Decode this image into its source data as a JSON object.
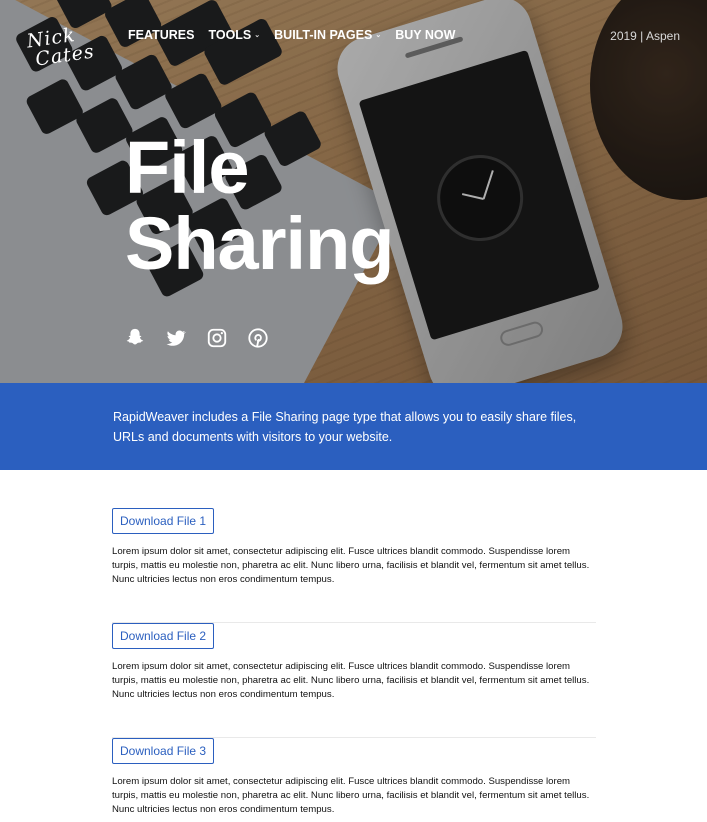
{
  "nav": {
    "logo_line1": "Nick",
    "logo_line2": "Cates",
    "items": [
      {
        "label": "FEATURES",
        "dropdown": false
      },
      {
        "label": "TOOLS",
        "dropdown": true
      },
      {
        "label": "BUILT-IN PAGES",
        "dropdown": true
      },
      {
        "label": "BUY NOW",
        "dropdown": false
      }
    ],
    "top_right": "2019 | Aspen"
  },
  "hero": {
    "title_line1": "File",
    "title_line2": "Sharing",
    "social_icons": [
      "snapchat-icon",
      "twitter-icon",
      "instagram-icon",
      "pinterest-icon"
    ]
  },
  "band": {
    "text": "RapidWeaver includes a File Sharing page type that allows you to easily share files, URLs and documents with visitors to your website."
  },
  "files": [
    {
      "button": "Download File 1",
      "description": "Lorem ipsum dolor sit amet, consectetur adipiscing elit. Fusce ultrices blandit commodo. Suspendisse lorem turpis, mattis eu molestie non, pharetra ac elit. Nunc libero urna, facilisis et blandit vel, fermentum sit amet tellus. Nunc ultricies lectus non eros condimentum tempus."
    },
    {
      "button": "Download File 2",
      "description": "Lorem ipsum dolor sit amet, consectetur adipiscing elit. Fusce ultrices blandit commodo. Suspendisse lorem turpis, mattis eu molestie non, pharetra ac elit. Nunc libero urna, facilisis et blandit vel, fermentum sit amet tellus. Nunc ultricies lectus non eros condimentum tempus."
    },
    {
      "button": "Download File 3",
      "description": "Lorem ipsum dolor sit amet, consectetur adipiscing elit. Fusce ultrices blandit commodo. Suspendisse lorem turpis, mattis eu molestie non, pharetra ac elit. Nunc libero urna, facilisis et blandit vel, fermentum sit amet tellus. Nunc ultricies lectus non eros condimentum tempus."
    }
  ],
  "colors": {
    "accent": "#2b5fbf",
    "text": "#111111",
    "divider": "#e9e9e9"
  }
}
